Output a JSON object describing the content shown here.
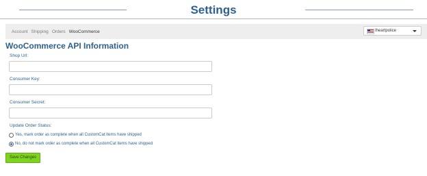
{
  "header": {
    "title": "Settings"
  },
  "nav": {
    "tabs": [
      {
        "label": "Account"
      },
      {
        "label": "Shipping"
      },
      {
        "label": "Orders"
      },
      {
        "label": "WooCommerce"
      }
    ],
    "active_tab": "WooCommerce",
    "store_selector": {
      "value": "Iheartpolice",
      "flag_icon": "us-flag-icon",
      "caret_icon": "caret-down-icon"
    }
  },
  "form": {
    "title": "WooCommerce API Information",
    "shop_url": {
      "label": "Shop Url:",
      "value": ""
    },
    "consumer_key": {
      "label": "Consumer Key:",
      "value": ""
    },
    "consumer_secret": {
      "label": "Consumer Secret:",
      "value": ""
    },
    "update_order_status": {
      "label": "Update Order Status:",
      "options": [
        {
          "label": "Yes, mark order as complete when all CustomCat items have shipped",
          "selected": false
        },
        {
          "label": "No, do not mark order as complete when all CustomCat items have shipped",
          "selected": true
        }
      ]
    },
    "save_label": "Save Changes"
  },
  "colors": {
    "heading": "#2d6191",
    "nav_bg": "#eeeeee",
    "save_button": "#7ed321"
  }
}
